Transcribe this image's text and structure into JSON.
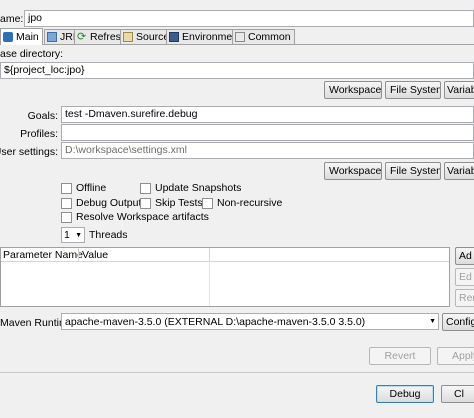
{
  "name": {
    "label": "ame:",
    "value": "jpo"
  },
  "tabs": [
    {
      "label": "Main",
      "icon": "main-tab-icon"
    },
    {
      "label": "JRE",
      "icon": "jre-icon"
    },
    {
      "label": "Refresh",
      "icon": "refresh-icon"
    },
    {
      "label": "Source",
      "icon": "source-icon"
    },
    {
      "label": "Environment",
      "icon": "environment-icon"
    },
    {
      "label": "Common",
      "icon": "common-icon"
    }
  ],
  "base_dir": {
    "label": "ase directory:",
    "value": "${project_loc:jpo}"
  },
  "buttons": {
    "workspace": "Workspace...",
    "file_system": "File System...",
    "variables": "Variab",
    "add": "Ad",
    "edit": "Ed",
    "remove": "Rem",
    "configure": "Configu",
    "revert": "Revert",
    "apply": "Apply",
    "debug": "Debug",
    "close": "Cl"
  },
  "goals": {
    "label": "Goals:",
    "value": "test -Dmaven.surefire.debug"
  },
  "profiles": {
    "label": "Profiles:",
    "value": ""
  },
  "user_settings": {
    "label": "User settings:",
    "value": "D:\\workspace\\settings.xml"
  },
  "options": {
    "offline": "Offline",
    "update_snapshots": "Update Snapshots",
    "debug_output": "Debug Output",
    "skip_tests": "Skip Tests",
    "non_recursive": "Non-recursive",
    "resolve_workspace": "Resolve Workspace artifacts"
  },
  "threads": {
    "value": "1",
    "label": "Threads"
  },
  "params_table": {
    "columns": [
      "Parameter Name",
      "Value"
    ],
    "rows": []
  },
  "runtime": {
    "label": "Maven Runtime:",
    "value": "apache-maven-3.5.0 (EXTERNAL D:\\apache-maven-3.5.0 3.5.0)"
  }
}
